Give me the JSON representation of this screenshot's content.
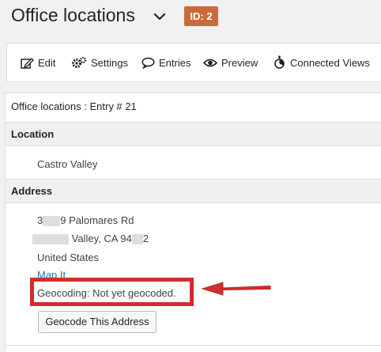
{
  "header": {
    "title": "Office locations",
    "badge": "ID: 2"
  },
  "toolbar": {
    "items": [
      {
        "label": "Edit",
        "icon": "edit-icon"
      },
      {
        "label": "Settings",
        "icon": "gear-icon"
      },
      {
        "label": "Entries",
        "icon": "speech-bubble-icon"
      },
      {
        "label": "Preview",
        "icon": "eye-icon"
      },
      {
        "label": "Connected Views",
        "icon": "connected-views-icon"
      }
    ]
  },
  "entry": {
    "title": "Office locations : Entry # 21",
    "location_label": "Location",
    "location_value": "Castro Valley",
    "address_label": "Address",
    "address_line1_a": "3",
    "address_line1_b": "9 Palomares Rd",
    "address_line2_a": "Valley, CA 94",
    "address_line2_b": "2",
    "country": "United States",
    "map_link": "Map It",
    "geocoding_status": "Geocoding: Not yet geocoded.",
    "geocode_button": "Geocode This Address"
  },
  "colors": {
    "badge": "#c96a3b",
    "highlight": "#d12d2d",
    "link": "#2271b1"
  }
}
